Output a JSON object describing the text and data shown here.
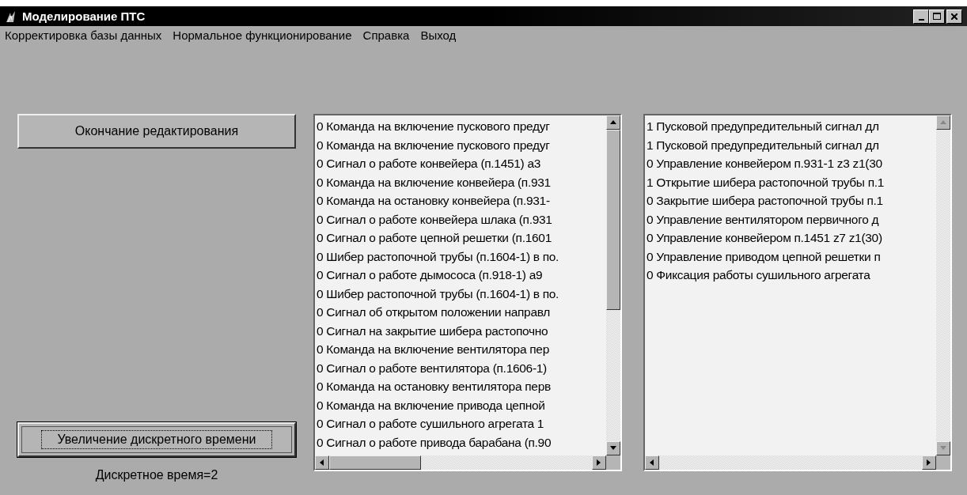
{
  "window": {
    "title": "Моделирование ПТС"
  },
  "menu": [
    "Корректировка базы данных",
    "Нормальное функционирование",
    "Справка",
    "Выход"
  ],
  "buttons": [
    {
      "label": "Окончание редактирования",
      "focused": false
    },
    {
      "label": "Увеличение дискретного времени",
      "focused": true
    }
  ],
  "status_label": "Дискретное время=2",
  "lists": [
    {
      "items": [
        "0 Команда на включение пускового предуг",
        "0 Команда на включение пускового предуг",
        "0 Сигнал о работе конвейера (п.1451) а3",
        "0 Команда на включение конвейера (п.931",
        "0 Команда на остановку конвейера (п.931-",
        "0 Сигнал о работе конвейера шлака (п.931",
        "0 Сигнал о работе цепной решетки (п.1601",
        "0 Шибер растопочной трубы (п.1604-1) в по.",
        "0 Сигнал о работе дымососа (п.918-1) а9",
        "0 Шибер растопочной трубы (п.1604-1) в по.",
        "0 Сигнал об открытом положении направл",
        "0 Сигнал на закрытие шибера растопочно",
        "0 Команда на включение вентилятора пер",
        "0 Сигнал о работе вентилятора (п.1606-1)",
        "0 Команда на остановку вентилятора перв",
        "0 Команда на включение привода цепной",
        "0 Сигнал о работе сушильного агрегата 1",
        "0 Сигнал о работе привода барабана (п.90"
      ]
    },
    {
      "items": [
        "1 Пусковой предупредительный сигнал дл",
        "1 Пусковой предупредительный сигнал дл",
        "0 Управление конвейером п.931-1 z3 z1(30",
        "1 Открытие шибера растопочной трубы п.1",
        "0 Закрытие шибера растопочной трубы п.1",
        "0 Управление вентилятором первичного д",
        "0 Управление конвейером п.1451 z7 z1(30)",
        "0 Управление приводом цепной решетки п",
        "0 Фиксация работы сушильного агрегата"
      ]
    }
  ]
}
